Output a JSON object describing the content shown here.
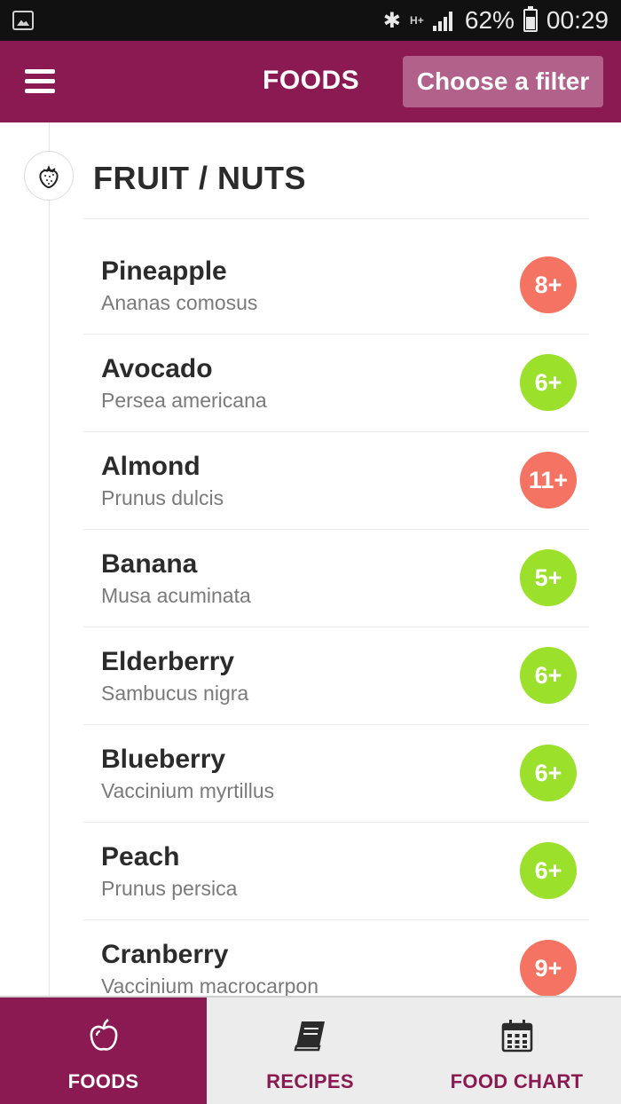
{
  "status_bar": {
    "battery_percent": "62%",
    "time": "00:29",
    "network": "H+"
  },
  "header": {
    "title": "FOODS",
    "filter_button": "Choose a filter",
    "background": "#8b1a52"
  },
  "category": {
    "icon": "strawberry-icon",
    "title": "FRUIT / NUTS"
  },
  "foods": [
    {
      "name": "Pineapple",
      "latin": "Ananas comosus",
      "age": "8+",
      "color": "#f47362"
    },
    {
      "name": "Avocado",
      "latin": "Persea americana",
      "age": "6+",
      "color": "#9be02a"
    },
    {
      "name": "Almond",
      "latin": "Prunus dulcis",
      "age": "11+",
      "color": "#f47362"
    },
    {
      "name": "Banana",
      "latin": "Musa acuminata",
      "age": "5+",
      "color": "#9be02a"
    },
    {
      "name": "Elderberry",
      "latin": "Sambucus nigra",
      "age": "6+",
      "color": "#9be02a"
    },
    {
      "name": "Blueberry",
      "latin": "Vaccinium myrtillus",
      "age": "6+",
      "color": "#9be02a"
    },
    {
      "name": "Peach",
      "latin": "Prunus persica",
      "age": "6+",
      "color": "#9be02a"
    },
    {
      "name": "Cranberry",
      "latin": "Vaccinium macrocarpon",
      "age": "9+",
      "color": "#f47362"
    }
  ],
  "bottom_nav": {
    "tabs": [
      {
        "label": "FOODS",
        "icon": "apple-icon",
        "active": true
      },
      {
        "label": "RECIPES",
        "icon": "book-icon",
        "active": false
      },
      {
        "label": "FOOD CHART",
        "icon": "calendar-icon",
        "active": false
      }
    ]
  }
}
